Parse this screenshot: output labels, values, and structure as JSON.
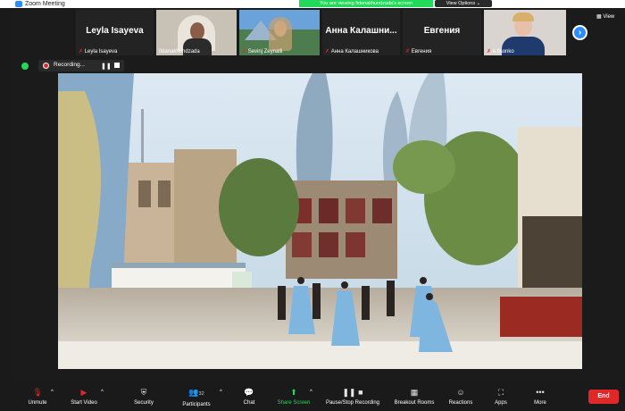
{
  "window": {
    "title": "Zoom Meeting"
  },
  "banner": {
    "share_text": "You are viewing fidanakhundzada's screen",
    "view_options": "View Options ⌄"
  },
  "participants": [
    {
      "big_name": "Leyla Isayeva",
      "label": "Leyla Isayeva",
      "muted": true
    },
    {
      "big_name": "",
      "label": "fidanakhundzada",
      "muted": false
    },
    {
      "big_name": "",
      "label": "Sevinj Zeynalli",
      "muted": true
    },
    {
      "big_name": "Анна Калашни...",
      "label": "Анна Калашникова",
      "muted": true
    },
    {
      "big_name": "Евгения",
      "label": "Евгения",
      "muted": true
    },
    {
      "big_name": "",
      "label": "e.fisonko",
      "muted": true
    }
  ],
  "view_button": "View",
  "recording": {
    "text": "Recording..."
  },
  "toolbar": {
    "unmute": "Unmute",
    "start_video": "Start Video",
    "security": "Security",
    "participants": "Participants",
    "participants_count": "32",
    "chat": "Chat",
    "share_screen": "Share Screen",
    "record": "Pause/Stop Recording",
    "breakout": "Breakout Rooms",
    "reactions": "Reactions",
    "apps": "Apps",
    "more": "More",
    "end": "End"
  },
  "icons": {
    "mic_muted": "microphone-muted-icon",
    "video_off": "video-off-icon",
    "security": "shield-icon",
    "participants": "people-icon",
    "chat": "chat-bubble-icon",
    "share": "share-screen-icon",
    "record": "record-icon",
    "breakout": "grid-icon",
    "reactions": "smiley-icon",
    "apps": "apps-icon",
    "more": "ellipsis-icon"
  },
  "colors": {
    "accent": "#2d8cff",
    "share_green": "#23d959",
    "end_red": "#e02828"
  }
}
